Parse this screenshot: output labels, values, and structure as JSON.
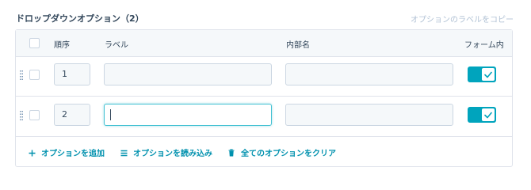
{
  "header": {
    "title": "ドロップダウンオプション（2）",
    "copy_labels_link": "オプションのラベルをコピー"
  },
  "table": {
    "columns": {
      "order": "順序",
      "label": "ラベル",
      "internal_name": "内部名",
      "in_form": "フォーム内"
    },
    "rows": [
      {
        "order": "1",
        "label": "",
        "internal_name": "",
        "in_form": true
      },
      {
        "order": "2",
        "label": "",
        "internal_name": "",
        "in_form": true
      }
    ]
  },
  "actions": {
    "add_option": "オプションを追加",
    "load_options": "オプションを読み込み",
    "clear_all": "全てのオプションをクリア"
  },
  "colors": {
    "accent": "#00a4bd",
    "link": "#0091ae",
    "muted_link": "#b0c1d4"
  },
  "icons": [
    "drag-handle-icon",
    "checkmark-icon",
    "plus-icon",
    "list-icon",
    "trash-icon"
  ]
}
